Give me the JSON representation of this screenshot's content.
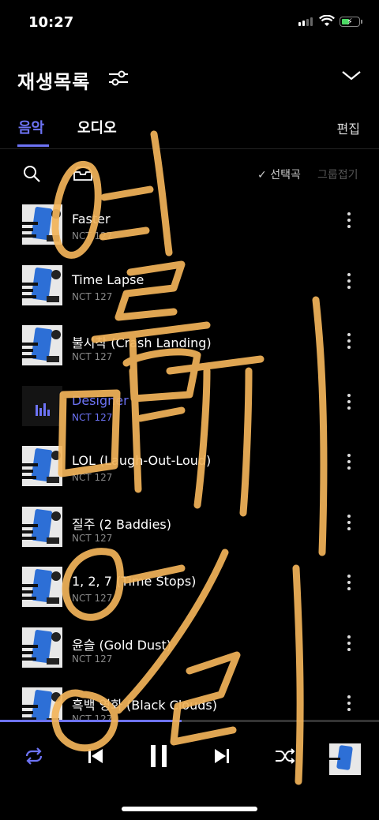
{
  "status": {
    "time": "10:27"
  },
  "header": {
    "title": "재생목록"
  },
  "tabs": {
    "music": "음악",
    "audio": "오디오",
    "edit": "편집"
  },
  "toolbar": {
    "select_song": "선택곡",
    "group_fold": "그룹접기"
  },
  "tracks": [
    {
      "title": "Faster",
      "artist": "NCT 127"
    },
    {
      "title": "Time Lapse",
      "artist": "NCT 127"
    },
    {
      "title": "불시착 (Crash Landing)",
      "artist": "NCT 127"
    },
    {
      "title": "Designer",
      "artist": "NCT 127"
    },
    {
      "title": "LOL (Laugh-Out-Loud)",
      "artist": "NCT 127"
    },
    {
      "title": "질주 (2 Baddies)",
      "artist": "NCT 127"
    },
    {
      "title": "1, 2, 7 (Time Stops)",
      "artist": "NCT 127"
    },
    {
      "title": "윤슬 (Gold Dust)",
      "artist": "NCT 127"
    },
    {
      "title": "흑백 영화 (Black Clouds)",
      "artist": "NCT 127"
    }
  ],
  "playback": {
    "progress_fraction": 0.48
  },
  "colors": {
    "accent": "#6d73f5",
    "background": "#000000",
    "scribble": "#f2b45a"
  },
  "icons": [
    "filter-icon",
    "chevron-down-icon",
    "search-icon",
    "box-icon",
    "check-icon",
    "more-icon",
    "repeat-icon",
    "previous-icon",
    "pause-icon",
    "next-icon",
    "shuffle-icon"
  ]
}
